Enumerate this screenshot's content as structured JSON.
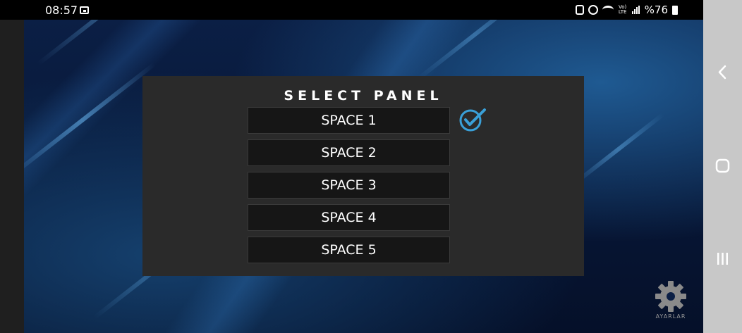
{
  "status_bar": {
    "time": "08:57",
    "volte_label": "Vo)\nLTE",
    "battery_text": "%76"
  },
  "panel": {
    "title": "SELECT PANEL",
    "options": [
      "SPACE 1",
      "SPACE 2",
      "SPACE 3",
      "SPACE 4",
      "SPACE 5"
    ],
    "selected_index": 0
  },
  "settings": {
    "label": "AYARLAR"
  },
  "colors": {
    "accent_check": "#3aa0d8",
    "panel_bg": "#2a2a2a",
    "button_bg": "#161616"
  },
  "icons": [
    "notification-icon",
    "lock-icon",
    "alarm-icon",
    "wifi-icon",
    "signal-icon",
    "battery-icon",
    "check-icon",
    "gear-icon",
    "back-icon",
    "home-icon",
    "recents-icon"
  ]
}
